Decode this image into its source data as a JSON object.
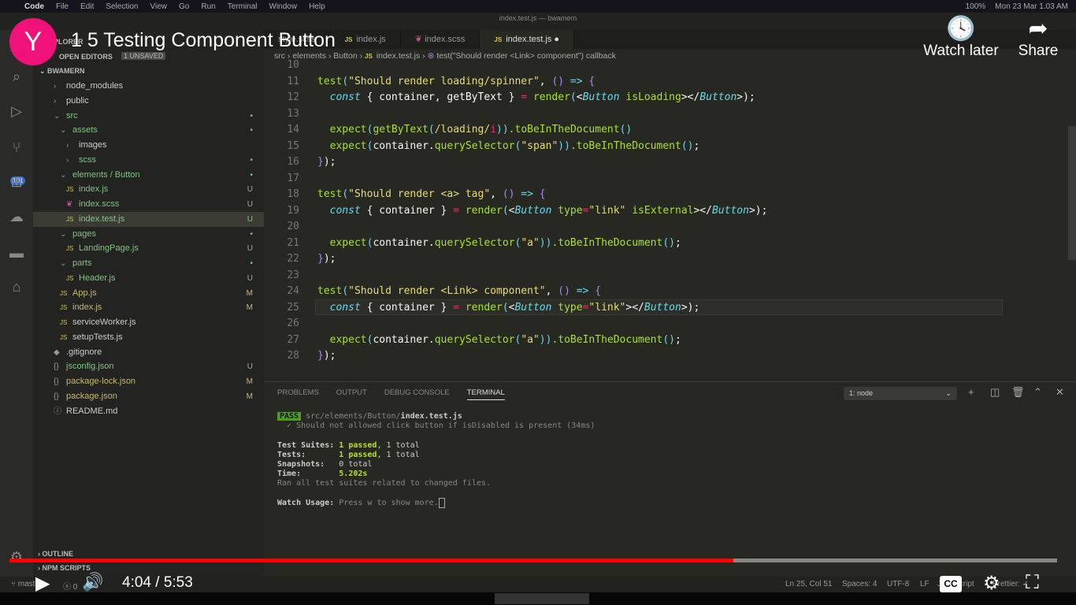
{
  "menubar": {
    "items": [
      "Code",
      "File",
      "Edit",
      "Selection",
      "View",
      "Go",
      "Run",
      "Terminal",
      "Window",
      "Help"
    ],
    "battery": "100%",
    "datetime": "Mon 23 Mar 1.03 AM"
  },
  "window_title": "index.test.js — bwamern",
  "activity": {
    "scm_badge": "101"
  },
  "explorer": {
    "title": "EXPLORER",
    "open_editors": "OPEN EDITORS",
    "unsaved_badge": "1 UNSAVED",
    "root": "BWAMERN",
    "items": [
      {
        "label": "node_modules",
        "indent": 1,
        "type": "folder-closed",
        "status": ""
      },
      {
        "label": "public",
        "indent": 1,
        "type": "folder-closed",
        "status": ""
      },
      {
        "label": "src",
        "indent": 1,
        "type": "folder-open",
        "status": "•"
      },
      {
        "label": "assets",
        "indent": 2,
        "type": "folder-open",
        "status": "•"
      },
      {
        "label": "images",
        "indent": 3,
        "type": "folder-closed",
        "status": ""
      },
      {
        "label": "scss",
        "indent": 3,
        "type": "folder-closed",
        "status": "•"
      },
      {
        "label": "elements / Button",
        "indent": 2,
        "type": "folder-open",
        "status": "•"
      },
      {
        "label": "index.js",
        "indent": 3,
        "type": "js",
        "status": "U"
      },
      {
        "label": "index.scss",
        "indent": 3,
        "type": "scss",
        "status": "U"
      },
      {
        "label": "index.test.js",
        "indent": 3,
        "type": "js",
        "status": "U",
        "selected": true
      },
      {
        "label": "pages",
        "indent": 2,
        "type": "folder-open",
        "status": "•"
      },
      {
        "label": "LandingPage.js",
        "indent": 3,
        "type": "js",
        "status": "U"
      },
      {
        "label": "parts",
        "indent": 2,
        "type": "folder-open",
        "status": "•"
      },
      {
        "label": "Header.js",
        "indent": 3,
        "type": "js",
        "status": "U"
      },
      {
        "label": "App.js",
        "indent": 2,
        "type": "js",
        "status": "M"
      },
      {
        "label": "index.js",
        "indent": 2,
        "type": "js",
        "status": "M"
      },
      {
        "label": "serviceWorker.js",
        "indent": 2,
        "type": "js",
        "status": ""
      },
      {
        "label": "setupTests.js",
        "indent": 2,
        "type": "js",
        "status": ""
      },
      {
        "label": ".gitignore",
        "indent": 1,
        "type": "file",
        "status": ""
      },
      {
        "label": "jsconfig.json",
        "indent": 1,
        "type": "json",
        "status": "U"
      },
      {
        "label": "package-lock.json",
        "indent": 1,
        "type": "json",
        "status": "M"
      },
      {
        "label": "package.json",
        "indent": 1,
        "type": "json",
        "status": "M"
      },
      {
        "label": "README.md",
        "indent": 1,
        "type": "info",
        "status": ""
      }
    ],
    "outline": "OUTLINE",
    "npm_scripts": "NPM SCRIPTS"
  },
  "tabs": [
    {
      "label": "style.scss"
    },
    {
      "label": "index.js"
    },
    {
      "label": "index.scss"
    },
    {
      "label": "index.test.js",
      "active": true,
      "dirty": "●"
    }
  ],
  "breadcrumbs": [
    "src",
    "elements",
    "Button",
    "index.test.js",
    "test(\"Should render <Link> component\") callback"
  ],
  "code": {
    "first_line": 10,
    "lines": [
      [],
      [
        [
          "test",
          "fn"
        ],
        [
          "(",
          "p"
        ],
        [
          "\"Should render loading/spinner\"",
          "str"
        ],
        [
          ", ",
          "t"
        ],
        [
          "()",
          "pk"
        ],
        [
          " => ",
          "p"
        ],
        [
          "{",
          "pk"
        ]
      ],
      [
        [
          "  ",
          " "
        ],
        [
          "const",
          "kw"
        ],
        [
          " { container, getByText } ",
          "t"
        ],
        [
          "=",
          "op"
        ],
        [
          " render",
          "fn"
        ],
        [
          "(",
          "p"
        ],
        [
          "<",
          "t"
        ],
        [
          "Button",
          "jsx"
        ],
        [
          " isLoading",
          "fn"
        ],
        [
          "></",
          "t"
        ],
        [
          "Button",
          "jsx"
        ],
        [
          ">",
          "t"
        ],
        [
          ");",
          "t"
        ]
      ],
      [],
      [
        [
          "  expect",
          "fn"
        ],
        [
          "(",
          "p"
        ],
        [
          "getByText",
          "fn"
        ],
        [
          "(",
          "p"
        ],
        [
          "/loading/",
          "str"
        ],
        [
          "i",
          "op"
        ],
        [
          "))",
          "p"
        ],
        [
          ".toBeInTheDocument",
          "fn"
        ],
        [
          "()",
          "p"
        ]
      ],
      [
        [
          "  expect",
          "fn"
        ],
        [
          "(",
          "p"
        ],
        [
          "container.",
          "t"
        ],
        [
          "querySelector",
          "fn"
        ],
        [
          "(",
          "p"
        ],
        [
          "\"span\"",
          "str"
        ],
        [
          "))",
          "p"
        ],
        [
          ".toBeInTheDocument",
          "fn"
        ],
        [
          "()",
          "p"
        ],
        [
          ";",
          "t"
        ]
      ],
      [
        [
          "}",
          "pk"
        ],
        [
          ");",
          "t"
        ]
      ],
      [],
      [
        [
          "test",
          "fn"
        ],
        [
          "(",
          "p"
        ],
        [
          "\"Should render <a> tag\"",
          "str"
        ],
        [
          ", ",
          "t"
        ],
        [
          "()",
          "pk"
        ],
        [
          " => ",
          "p"
        ],
        [
          "{",
          "pk"
        ]
      ],
      [
        [
          "  ",
          " "
        ],
        [
          "const",
          "kw"
        ],
        [
          " { container } ",
          "t"
        ],
        [
          "=",
          "op"
        ],
        [
          " render",
          "fn"
        ],
        [
          "(",
          "p"
        ],
        [
          "<",
          "t"
        ],
        [
          "Button",
          "jsx"
        ],
        [
          " type",
          "fn"
        ],
        [
          "=",
          "op"
        ],
        [
          "\"link\"",
          "str"
        ],
        [
          " isExternal",
          "fn"
        ],
        [
          "></",
          "t"
        ],
        [
          "Button",
          "jsx"
        ],
        [
          ">",
          "t"
        ],
        [
          ");",
          "t"
        ]
      ],
      [],
      [
        [
          "  expect",
          "fn"
        ],
        [
          "(",
          "p"
        ],
        [
          "container.",
          "t"
        ],
        [
          "querySelector",
          "fn"
        ],
        [
          "(",
          "p"
        ],
        [
          "\"a\"",
          "str"
        ],
        [
          "))",
          "p"
        ],
        [
          ".toBeInTheDocument",
          "fn"
        ],
        [
          "()",
          "p"
        ],
        [
          ";",
          "t"
        ]
      ],
      [
        [
          "}",
          "pk"
        ],
        [
          ");",
          "t"
        ]
      ],
      [],
      [
        [
          "test",
          "fn"
        ],
        [
          "(",
          "p"
        ],
        [
          "\"Should render <Link> component\"",
          "str"
        ],
        [
          ", ",
          "t"
        ],
        [
          "()",
          "pk"
        ],
        [
          " => ",
          "p"
        ],
        [
          "{",
          "pk"
        ]
      ],
      [
        [
          "  ",
          " "
        ],
        [
          "const",
          "kw"
        ],
        [
          " { container } ",
          "t"
        ],
        [
          "=",
          "op"
        ],
        [
          " render",
          "fn"
        ],
        [
          "(",
          "p"
        ],
        [
          "<",
          "t"
        ],
        [
          "Button",
          "jsx"
        ],
        [
          " type",
          "fn"
        ],
        [
          "=",
          "op"
        ],
        [
          "\"link\"",
          "str"
        ],
        [
          "></",
          "t"
        ],
        [
          "Button",
          "jsx"
        ],
        [
          ">",
          "t"
        ],
        [
          ");",
          "t"
        ]
      ],
      [],
      [
        [
          "  expect",
          "fn"
        ],
        [
          "(",
          "p"
        ],
        [
          "container.",
          "t"
        ],
        [
          "querySelector",
          "fn"
        ],
        [
          "(",
          "p"
        ],
        [
          "\"a\"",
          "str"
        ],
        [
          "))",
          "p"
        ],
        [
          ".toBeInTheDocument",
          "fn"
        ],
        [
          "()",
          "p"
        ],
        [
          ";",
          "t"
        ]
      ],
      [
        [
          "}",
          "pk"
        ],
        [
          ");",
          "t"
        ]
      ]
    ]
  },
  "panel": {
    "tabs": [
      "PROBLEMS",
      "OUTPUT",
      "DEBUG CONSOLE",
      "TERMINAL"
    ],
    "active_tab": "TERMINAL",
    "terminal_select": "1: node",
    "terminal": {
      "pass": "PASS",
      "path": "src/elements/Button/",
      "file": "index.test.js",
      "test_line": "  ✓ Should not allowed click button if isDisabled is present (34ms)",
      "suites_label": "Test Suites: ",
      "suites_passed": "1 passed",
      "suites_total": ", 1 total",
      "tests_label": "Tests:       ",
      "tests_passed": "1 passed",
      "tests_total": ", 1 total",
      "snap_label": "Snapshots:   ",
      "snap_value": "0 total",
      "time_label": "Time:        ",
      "time_value": "5.202s",
      "ran": "Ran all test suites related to changed files.",
      "watch_label": "Watch Usage: ",
      "watch_text": "Press w to show more."
    }
  },
  "statusbar": {
    "branch": "master",
    "errors": "0",
    "position": "Ln 25, Col 51",
    "spaces": "Spaces: 4",
    "encoding": "UTF-8",
    "eol": "LF",
    "language": "JavaScript",
    "prettier": "Prettier: ✓"
  },
  "youtube": {
    "channel_initial": "Y",
    "title": "1 5 Testing Component Button",
    "watch_later": "Watch later",
    "share": "Share",
    "current_time": "4:04",
    "duration": "5:53",
    "progress_fraction": 0.691,
    "colors": {
      "progress": "#ff0000",
      "avatar": "#f0127a"
    }
  }
}
